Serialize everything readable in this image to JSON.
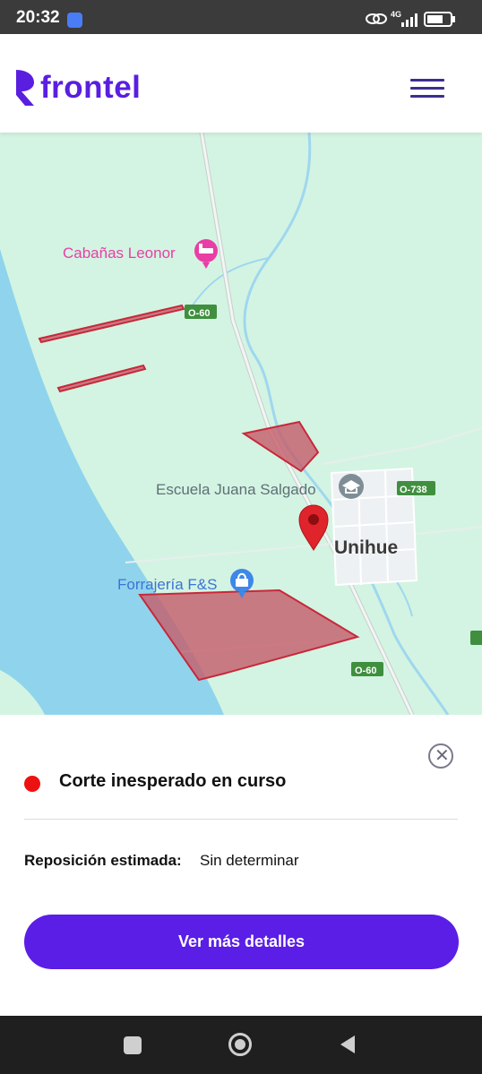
{
  "status_bar": {
    "time": "20:32",
    "network": "4G",
    "icons": [
      "sync-badge-icon",
      "hotspot-link-icon",
      "signal-icon",
      "battery-icon"
    ]
  },
  "header": {
    "brand": "frontel",
    "brand_color": "#5a1ee0",
    "menu_icon": "hamburger-menu-icon"
  },
  "map": {
    "places": {
      "cabin": "Cabañas Leonor",
      "school": "Escuela Juana Salgado",
      "store": "Forrajería F&S",
      "town": "Unihue"
    },
    "roads": {
      "road_a": "O-60",
      "road_b": "O-738",
      "road_c": "O-60"
    },
    "colors": {
      "land": "#d3f4e2",
      "water": "#8fd4ec",
      "outage_area": "#c65b6a",
      "marker": "#e0242b"
    }
  },
  "panel": {
    "status_title": "Corte inesperado en curso",
    "status_color": "#ee1111",
    "restore_label": "Reposición estimada:",
    "restore_value": "Sin determinar",
    "details_button": "Ver más detalles",
    "close_icon": "close-circle-icon",
    "accent": "#5a1ee6"
  },
  "nav_bar": {
    "icons": [
      "recent-apps-icon",
      "home-icon",
      "back-icon"
    ]
  }
}
